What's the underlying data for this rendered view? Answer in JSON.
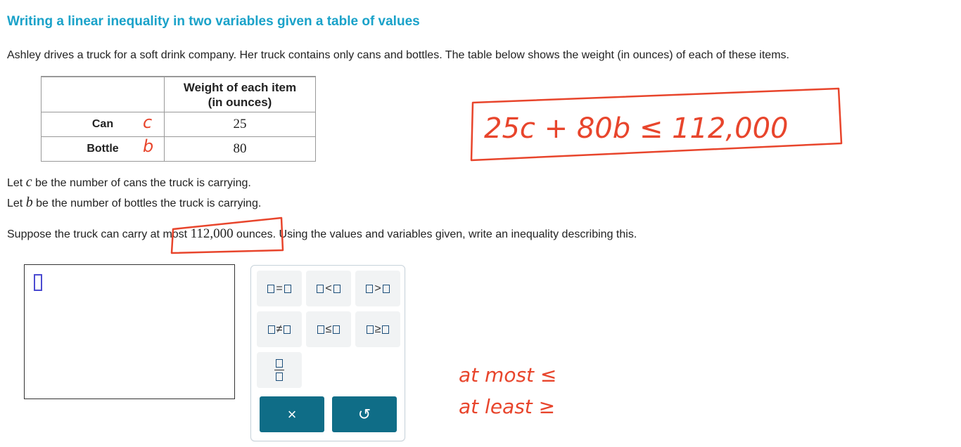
{
  "title": "Writing a linear inequality in two variables given a table of values",
  "problem": {
    "intro": "Ashley drives a truck for a soft drink company. Her truck contains only cans and bottles. The table below shows the weight (in ounces) of each of these items.",
    "table": {
      "header_line1": "Weight of each item",
      "header_line2": "(in ounces)",
      "rows": [
        {
          "label": "Can",
          "value": "25"
        },
        {
          "label": "Bottle",
          "value": "80"
        }
      ]
    },
    "let_c": {
      "pre": "Let ",
      "var": "c",
      "post": " be the number of cans the truck is carrying."
    },
    "let_b": {
      "pre": "Let ",
      "var": "b",
      "post": " be the number of bottles the truck is carrying."
    },
    "suppose": {
      "pre": "Suppose the truck can carry at most ",
      "number": "112,000",
      "post": " ounces. Using the values and variables given, write an inequality describing this."
    }
  },
  "keypad": {
    "keys": [
      {
        "name": "equals-key",
        "op": "="
      },
      {
        "name": "less-than-key",
        "op": "<"
      },
      {
        "name": "greater-than-key",
        "op": ">"
      },
      {
        "name": "not-equal-key",
        "op": "≠"
      },
      {
        "name": "less-equal-key",
        "op": "≤"
      },
      {
        "name": "greater-equal-key",
        "op": "≥"
      }
    ],
    "clear_symbol": "×",
    "undo_symbol": "↺"
  },
  "annotations": {
    "row_can": "c",
    "row_bottle": "b",
    "inequality": "25c + 80b ≤ 112,000",
    "at_most": "at most ≤",
    "at_least": "at least ≥",
    "ink_color": "#e8452c"
  },
  "colors": {
    "title": "#1aa2c9",
    "action_button": "#0f6d87",
    "cursor": "#4b4bd1"
  }
}
